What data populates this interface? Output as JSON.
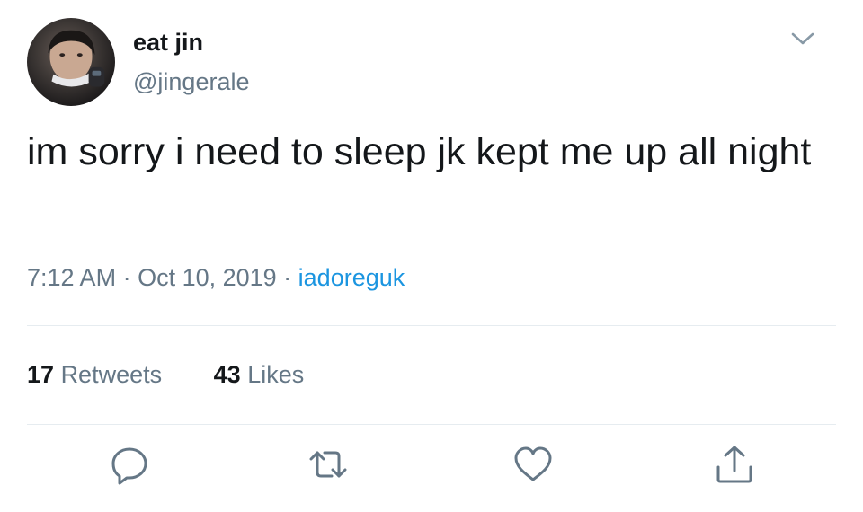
{
  "user": {
    "display_name": "eat jin",
    "handle": "@jingerale",
    "avatar_icon": "profile-photo"
  },
  "tweet": {
    "text": "im sorry i need to sleep jk kept me up all night",
    "time": "7:12 AM",
    "date": "Oct 10, 2019",
    "source": "iadoreguk",
    "separator": " · "
  },
  "stats": {
    "retweets_count": "17",
    "retweets_label": "Retweets",
    "likes_count": "43",
    "likes_label": "Likes"
  },
  "actions": [
    {
      "icon": "reply-icon"
    },
    {
      "icon": "retweet-icon"
    },
    {
      "icon": "like-icon"
    },
    {
      "icon": "share-icon"
    }
  ],
  "colors": {
    "text": "#14171a",
    "secondary": "#657786",
    "link": "#1b95e0",
    "divider": "#e6ecf0"
  }
}
